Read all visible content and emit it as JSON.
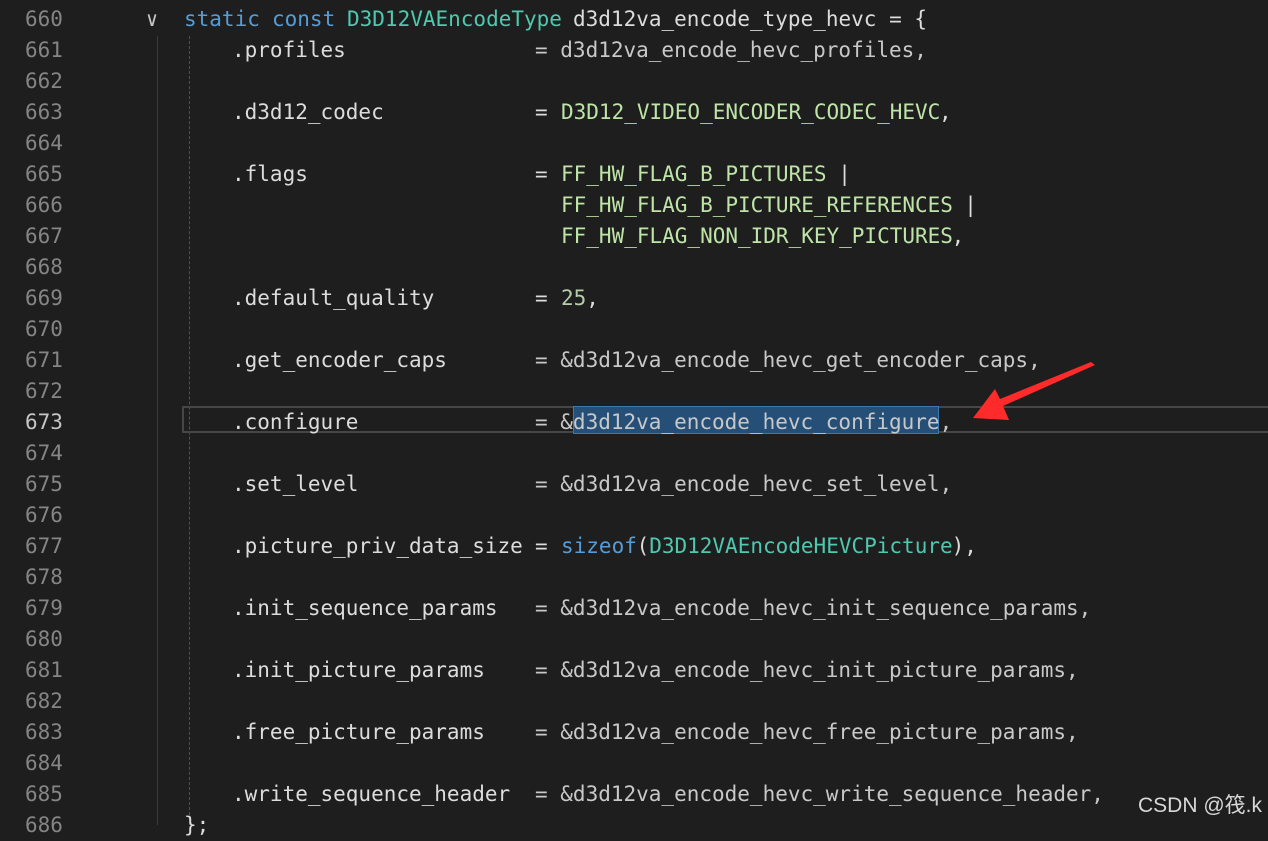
{
  "editor": {
    "lines": [
      {
        "num": "660",
        "parts": [
          [
            "kw",
            "static"
          ],
          [
            "kw",
            "const"
          ],
          [
            "type",
            "D3D12VAEncodeType"
          ],
          [
            "ident",
            "d3d12va_encode_type_hevc = {"
          ]
        ]
      },
      {
        "num": "661",
        "field": ".profiles",
        "value": "= d3d12va_encode_hevc_profiles,"
      },
      {
        "num": "662"
      },
      {
        "num": "663",
        "field": ".d3d12_codec",
        "value_macro": "D3D12_VIDEO_ENCODER_CODEC_HEVC",
        "value_tail": ","
      },
      {
        "num": "664"
      },
      {
        "num": "665",
        "field": ".flags",
        "value_macro": "FF_HW_FLAG_B_PICTURES",
        "value_tail": " |"
      },
      {
        "num": "666",
        "cont_macro": "FF_HW_FLAG_B_PICTURE_REFERENCES",
        "cont_tail": " |"
      },
      {
        "num": "667",
        "cont_macro": "FF_HW_FLAG_NON_IDR_KEY_PICTURES",
        "cont_tail": ","
      },
      {
        "num": "668"
      },
      {
        "num": "669",
        "field": ".default_quality",
        "value_num": "25",
        "value_tail": ","
      },
      {
        "num": "670"
      },
      {
        "num": "671",
        "field": ".get_encoder_caps",
        "value": "= &d3d12va_encode_hevc_get_encoder_caps,"
      },
      {
        "num": "672"
      },
      {
        "num": "673",
        "field": ".configure",
        "value": "= &d3d12va_encode_hevc_configure,",
        "active": true
      },
      {
        "num": "674"
      },
      {
        "num": "675",
        "field": ".set_level",
        "value": "= &d3d12va_encode_hevc_set_level,"
      },
      {
        "num": "676"
      },
      {
        "num": "677",
        "field": ".picture_priv_data_size",
        "value_sizeof": "sizeof",
        "value_type": "D3D12VAEncodeHEVCPicture",
        "value_tail": "),"
      },
      {
        "num": "678"
      },
      {
        "num": "679",
        "field": ".init_sequence_params",
        "value": "= &d3d12va_encode_hevc_init_sequence_params,"
      },
      {
        "num": "680"
      },
      {
        "num": "681",
        "field": ".init_picture_params",
        "value": "= &d3d12va_encode_hevc_init_picture_params,"
      },
      {
        "num": "682"
      },
      {
        "num": "683",
        "field": ".free_picture_params",
        "value": "= &d3d12va_encode_hevc_free_picture_params,"
      },
      {
        "num": "684"
      },
      {
        "num": "685",
        "field": ".write_sequence_header",
        "value": "= &d3d12va_encode_hevc_write_sequence_header,"
      },
      {
        "num": "686",
        "closing": "};"
      }
    ],
    "colors": {
      "background": "#1e1e1e",
      "keyword": "#569cd6",
      "type": "#4ec9b0",
      "macro": "#bee4a8",
      "selection": "#264f78",
      "arrow": "#ff2b2b"
    }
  },
  "fold_icon": "chevron-down-icon",
  "watermark": "CSDN @筏.k"
}
